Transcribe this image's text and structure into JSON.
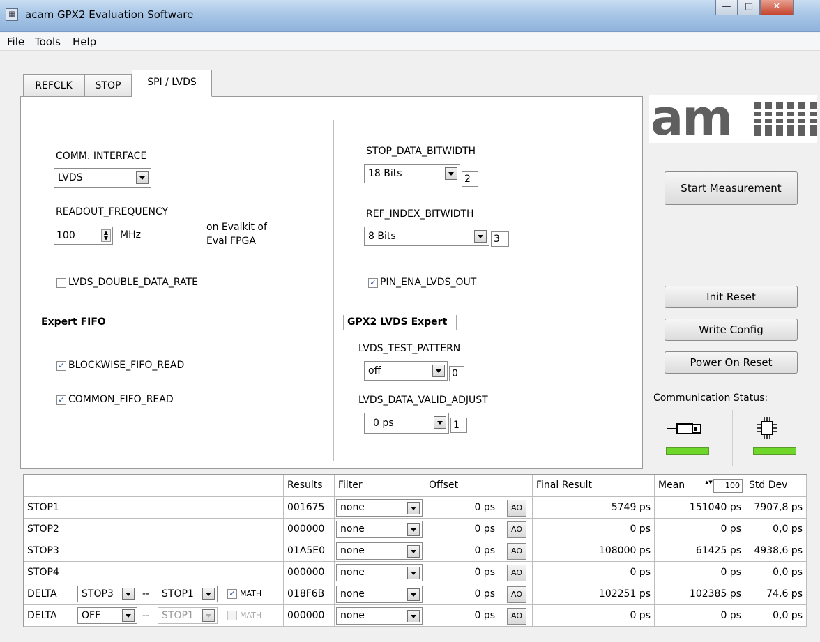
{
  "window": {
    "title": "acam GPX2 Evaluation Software",
    "app_icon": "grid-icon"
  },
  "menu": [
    "File",
    "Tools",
    "Help"
  ],
  "tabs": [
    {
      "label": "REFCLK",
      "active": false
    },
    {
      "label": "STOP",
      "active": false
    },
    {
      "label": "SPI / LVDS",
      "active": true
    }
  ],
  "left": {
    "comm_interface_label": "COMM. INTERFACE",
    "comm_interface_value": "LVDS",
    "readout_frequency_label": "READOUT_FREQUENCY",
    "readout_frequency_value": "100",
    "readout_frequency_unit": "MHz",
    "evalkit_note_line1": "on Evalkit of",
    "evalkit_note_line2": "Eval FPGA",
    "lvds_ddr_label": "LVDS_DOUBLE_DATA_RATE",
    "lvds_ddr_checked": false,
    "expert_fifo_title": "Expert FIFO",
    "blockwise_label": "BLOCKWISE_FIFO_READ",
    "blockwise_checked": true,
    "common_label": "COMMON_FIFO_READ",
    "common_checked": true
  },
  "right": {
    "stop_data_label": "STOP_DATA_BITWIDTH",
    "stop_data_value": "18 Bits",
    "stop_data_code": "2",
    "ref_index_label": "REF_INDEX_BITWIDTH",
    "ref_index_value": "8 Bits",
    "ref_index_code": "3",
    "pin_ena_label": "PIN_ENA_LVDS_OUT",
    "pin_ena_checked": true,
    "lvds_expert_title": "GPX2 LVDS Expert",
    "test_pattern_label": "LVDS_TEST_PATTERN",
    "test_pattern_value": "off",
    "test_pattern_code": "0",
    "valid_adjust_label": "LVDS_DATA_VALID_ADJUST",
    "valid_adjust_value": "0 ps",
    "valid_adjust_code": "1"
  },
  "sidebar": {
    "logo_text": "am",
    "start_label": "Start Measurement",
    "init_reset_label": "Init Reset",
    "write_config_label": "Write Config",
    "power_on_reset_label": "Power On Reset",
    "comm_status_label": "Communication Status:",
    "usb_icon": "usb-icon",
    "chip_icon": "chip-icon",
    "led_color": "#6fd62a"
  },
  "table": {
    "headers": {
      "results": "Results",
      "filter": "Filter",
      "offset": "Offset",
      "final": "Final Result",
      "mean": "Mean",
      "mean_count": "100",
      "std": "Std Dev"
    },
    "rows": [
      {
        "name": "STOP1",
        "result": "001675",
        "filter": "none",
        "offset": "0 ps",
        "ao": "AO",
        "final": "5749 ps",
        "mean": "151040 ps",
        "std": "7907,8 ps"
      },
      {
        "name": "STOP2",
        "result": "000000",
        "filter": "none",
        "offset": "0 ps",
        "ao": "AO",
        "final": "0 ps",
        "mean": "0 ps",
        "std": "0,0 ps"
      },
      {
        "name": "STOP3",
        "result": "01A5E0",
        "filter": "none",
        "offset": "0 ps",
        "ao": "AO",
        "final": "108000 ps",
        "mean": "61425 ps",
        "std": "4938,6 ps"
      },
      {
        "name": "STOP4",
        "result": "000000",
        "filter": "none",
        "offset": "0 ps",
        "ao": "AO",
        "final": "0 ps",
        "mean": "0 ps",
        "std": "0,0 ps"
      },
      {
        "name": "DELTA",
        "a": "STOP3",
        "sep": "--",
        "b": "STOP1",
        "math": "MATH",
        "math_checked": true,
        "disabled": false,
        "result": "018F6B",
        "filter": "none",
        "offset": "0 ps",
        "ao": "AO",
        "final": "102251 ps",
        "mean": "102385 ps",
        "std": "74,6 ps"
      },
      {
        "name": "DELTA",
        "a": "OFF",
        "sep": "--",
        "b": "STOP1",
        "math": "MATH",
        "math_checked": false,
        "disabled": true,
        "result": "000000",
        "filter": "none",
        "offset": "0 ps",
        "ao": "AO",
        "final": "0 ps",
        "mean": "0 ps",
        "std": "0,0 ps"
      }
    ]
  }
}
